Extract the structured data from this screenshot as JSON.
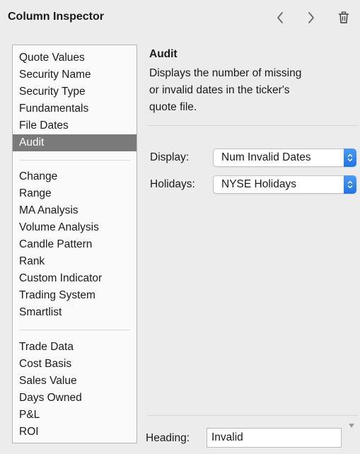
{
  "header": {
    "title": "Column Inspector",
    "back_icon": "chevron-left-icon",
    "forward_icon": "chevron-right-icon",
    "delete_icon": "trash-icon"
  },
  "column_list": {
    "groups": [
      [
        "Quote Values",
        "Security Name",
        "Security Type",
        "Fundamentals",
        "File Dates",
        "Audit"
      ],
      [
        "Change",
        "Range",
        "MA Analysis",
        "Volume Analysis",
        "Candle Pattern",
        "Rank",
        "Custom Indicator",
        "Trading System",
        "Smartlist"
      ],
      [
        "Trade Data",
        "Cost Basis",
        "Sales Value",
        "Days Owned",
        "P&L",
        "ROI"
      ]
    ],
    "selected": "Audit",
    "selection_color": "#7a7a7a"
  },
  "detail": {
    "title": "Audit",
    "description_lines": [
      "Displays the number of missing",
      "or invalid dates in the ticker's",
      "quote file."
    ]
  },
  "form": {
    "display_label": "Display:",
    "display_value": "Num Invalid Dates",
    "holidays_label": "Holidays:",
    "holidays_value": "NYSE Holidays",
    "stepper_icon": "up-down-chevron-icon",
    "accent_color": "#2a82f0"
  },
  "footer": {
    "heading_label": "Heading:",
    "heading_value": "Invalid",
    "dropdown_icon": "triangle-down-icon"
  }
}
